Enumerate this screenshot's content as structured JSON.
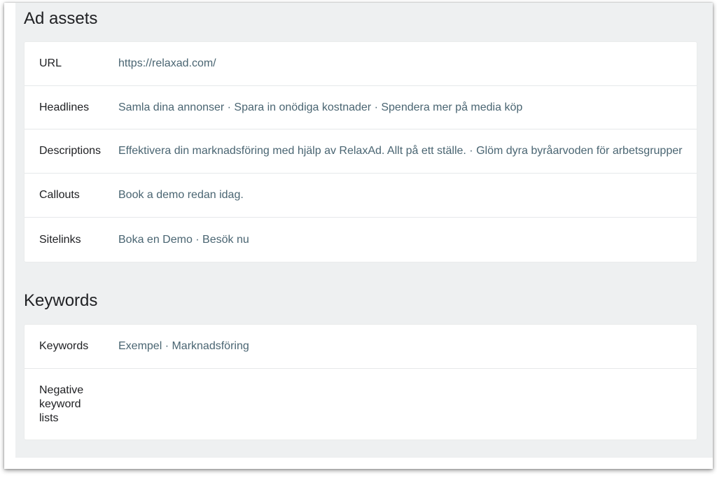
{
  "ad_assets": {
    "title": "Ad assets",
    "rows": [
      {
        "label": "URL",
        "value": "https://relaxad.com/"
      },
      {
        "label": "Headlines",
        "value": "Samla dina annonser · Spara in onödiga kostnader · Spendera mer på media köp"
      },
      {
        "label": "Descriptions",
        "value": "Effektivera din marknadsföring med hjälp av RelaxAd. Allt på ett ställe. · Glöm dyra byråarvoden för arbetsgrupper"
      },
      {
        "label": "Callouts",
        "value": "Book a demo redan idag."
      },
      {
        "label": "Sitelinks",
        "value": "Boka en Demo · Besök nu"
      }
    ]
  },
  "keywords": {
    "title": "Keywords",
    "rows": [
      {
        "label": "Keywords",
        "value": "Exempel · Marknadsföring"
      },
      {
        "label": "Negative keyword lists",
        "value": ""
      }
    ]
  }
}
